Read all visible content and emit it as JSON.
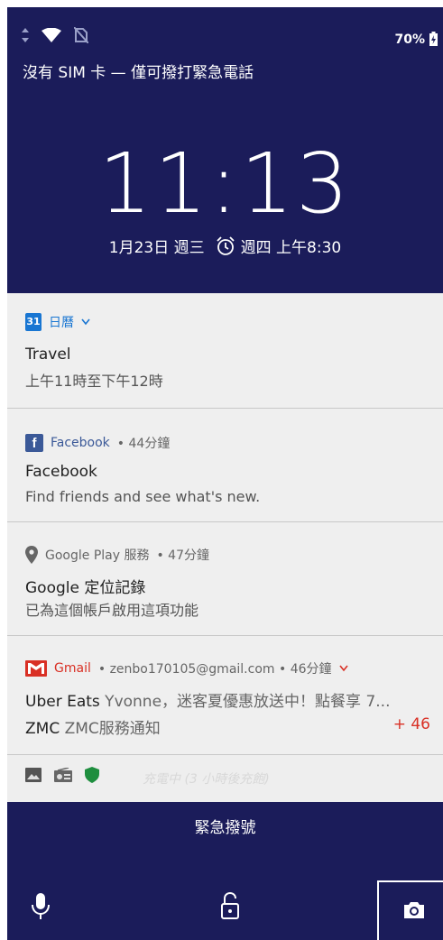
{
  "status_bar": {
    "battery": "70%",
    "icons": [
      "data-arrows-icon",
      "wifi-icon",
      "no-sim-icon",
      "battery-charging-icon"
    ]
  },
  "carrier_text": "沒有 SIM 卡 — 僅可撥打緊急電話",
  "clock": {
    "time": "11:13",
    "date": "1月23日 週三",
    "alarm": "週四 上午8:30"
  },
  "notifications": {
    "calendar": {
      "app": "日曆",
      "title": "Travel",
      "body": "上午11時至下午12時",
      "icon_text": "31"
    },
    "facebook": {
      "app": "Facebook",
      "meta": "• 44分鐘",
      "title": "Facebook",
      "body": "Find friends and see what's new.",
      "icon_text": "f"
    },
    "google_play": {
      "app": "Google Play 服務",
      "meta": "• 47分鐘",
      "title": "Google 定位記錄",
      "body": "已為這個帳戶啟用這項功能"
    },
    "gmail": {
      "app": "Gmail",
      "meta": "• zenbo170105@gmail.com • 46分鐘",
      "line1_sender": "Uber Eats",
      "line1_text": " Yvonne，迷客夏優惠放送中！點餐享 7...",
      "line2_sender": "ZMC",
      "line2_text": " ZMC服務通知",
      "count": "+ 46"
    },
    "charging": "充電中 (3 小時後充飽)"
  },
  "emergency_call": "緊急撥號",
  "colors": {
    "background": "#1b1c5a",
    "calendar": "#1976d2",
    "facebook": "#3b5998",
    "gmail": "#d93025",
    "shield": "#1e8e3e"
  }
}
